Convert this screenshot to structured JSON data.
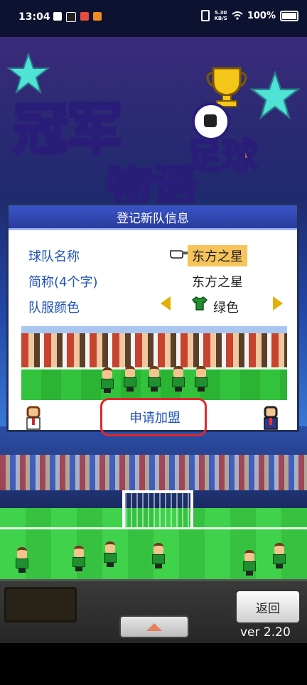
{
  "status_bar": {
    "time": "13:04",
    "net_speed_top": "5.30",
    "net_speed_bottom": "KB/S",
    "battery": "100%"
  },
  "game": {
    "logo_line1": "冠军",
    "logo_line2": "足球",
    "logo_line3": "物语"
  },
  "dialog": {
    "title": "登记新队信息",
    "rows": [
      {
        "label": "球队名称",
        "value": "东方之星"
      },
      {
        "label": "简称(4个字)",
        "value": "东方之星"
      },
      {
        "label": "队服颜色",
        "value": "绿色"
      }
    ],
    "join_label": "申请加盟"
  },
  "bottom": {
    "back_label": "返回",
    "version": "ver 2.20"
  },
  "colors": {
    "dialog_title_bg": "#2a3c9c",
    "label_blue": "#1e52b8",
    "highlight": "#f7c35b",
    "annotation_red": "#e0282c",
    "kit_green": "#1f8f2f"
  }
}
